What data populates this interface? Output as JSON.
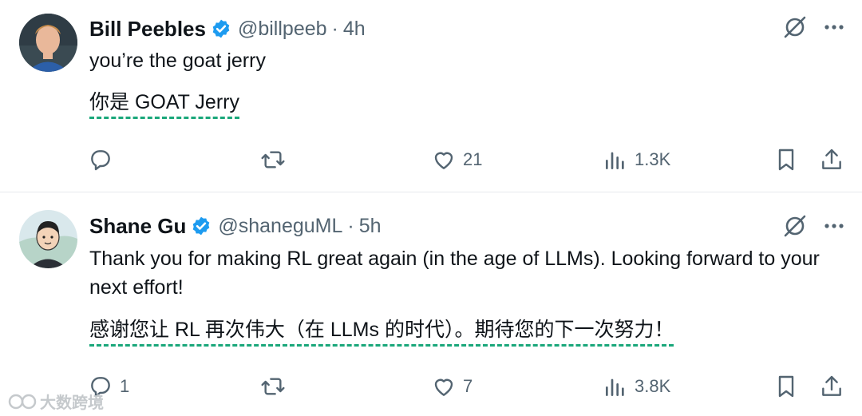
{
  "colors": {
    "verified_blue": "#1d9bf0",
    "translation_underline": "#1aa77a",
    "muted": "#536471"
  },
  "tweets": [
    {
      "name": "Bill Peebles",
      "handle": "@billpeeb",
      "time": "4h",
      "text": "you’re the goat jerry",
      "translation": "你是 GOAT Jerry",
      "replies": "",
      "retweets": "",
      "likes": "21",
      "views": "1.3K"
    },
    {
      "name": "Shane Gu",
      "handle": "@shaneguML",
      "time": "5h",
      "text": "Thank you for making RL great again (in the age of LLMs). Looking forward to your next effort!",
      "translation": "感谢您让 RL 再次伟大（在 LLMs 的时代）。期待您的下一次努力！",
      "replies": "1",
      "retweets": "",
      "likes": "7",
      "views": "3.8K"
    }
  ],
  "separator": "·",
  "watermark": "大数跨境",
  "icons": [
    "verified-icon",
    "grok-icon",
    "more-icon",
    "reply-icon",
    "retweet-icon",
    "like-icon",
    "views-icon",
    "bookmark-icon",
    "share-icon"
  ]
}
